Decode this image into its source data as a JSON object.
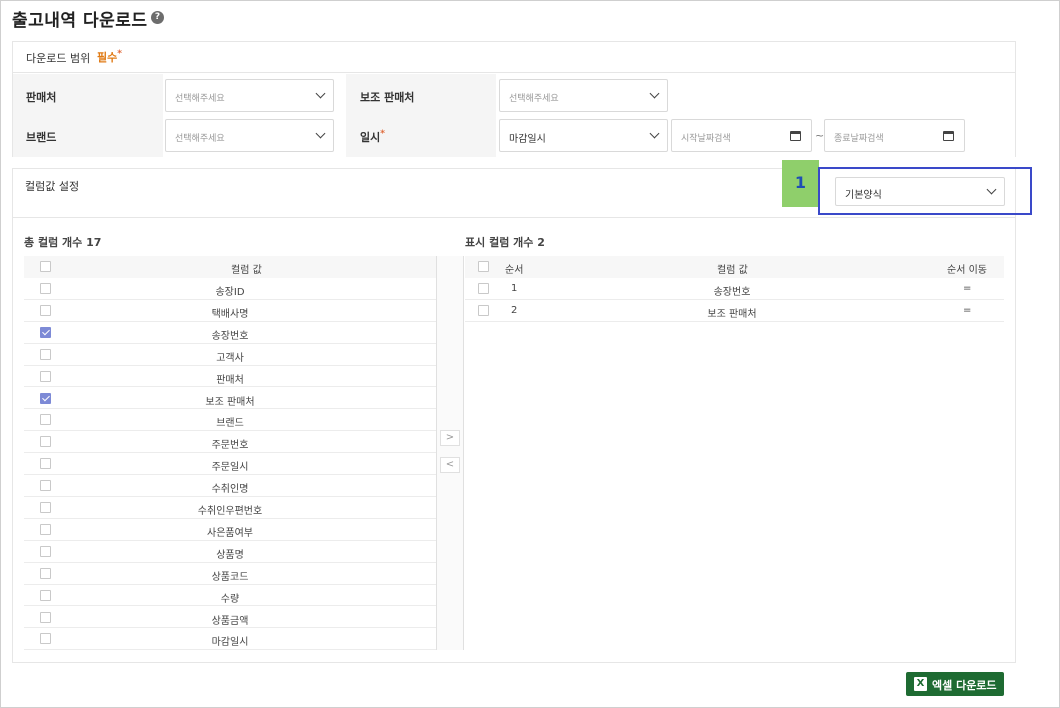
{
  "page": {
    "title": "출고내역 다운로드",
    "help_icon": "question-circle-icon"
  },
  "range": {
    "heading": "다운로드 범위",
    "required": "필수",
    "seller_label": "판매처",
    "seller_placeholder": "선택해주세요",
    "sub_seller_label": "보조 판매처",
    "sub_seller_placeholder": "선택해주세요",
    "brand_label": "브랜드",
    "brand_placeholder": "선택해주세요",
    "datetime_label": "일시",
    "datetime_type_value": "마감일시",
    "start_placeholder": "시작날짜검색",
    "end_placeholder": "종료날짜검색",
    "separator": "~"
  },
  "column_setting": {
    "label": "컬럼값 설정",
    "template_value": "기본양식",
    "annotation_number": "1"
  },
  "total_columns": {
    "title": "총 컬럼 개수 17",
    "header": "컬럼 값",
    "items": [
      {
        "label": "송장ID",
        "checked": false
      },
      {
        "label": "택배사명",
        "checked": false
      },
      {
        "label": "송장번호",
        "checked": true
      },
      {
        "label": "고객사",
        "checked": false
      },
      {
        "label": "판매처",
        "checked": false
      },
      {
        "label": "보조 판매처",
        "checked": true
      },
      {
        "label": "브랜드",
        "checked": false
      },
      {
        "label": "주문번호",
        "checked": false
      },
      {
        "label": "주문일시",
        "checked": false
      },
      {
        "label": "수취인명",
        "checked": false
      },
      {
        "label": "수취인우편번호",
        "checked": false
      },
      {
        "label": "사은품여부",
        "checked": false
      },
      {
        "label": "상품명",
        "checked": false
      },
      {
        "label": "상품코드",
        "checked": false
      },
      {
        "label": "수량",
        "checked": false
      },
      {
        "label": "상품금액",
        "checked": false
      },
      {
        "label": "마감일시",
        "checked": false
      }
    ]
  },
  "move": {
    "right": ">",
    "left": "<"
  },
  "display_columns": {
    "title": "표시 컬럼 개수 2",
    "header_order": "순서",
    "header_value": "컬럼 값",
    "header_move": "순서 이동",
    "rows": [
      {
        "order": "1",
        "value": "송장번호",
        "handle": "="
      },
      {
        "order": "2",
        "value": "보조 판매처",
        "handle": "="
      }
    ]
  },
  "actions": {
    "excel_download": "엑셀 다운로드",
    "excel_icon": "excel-icon"
  }
}
